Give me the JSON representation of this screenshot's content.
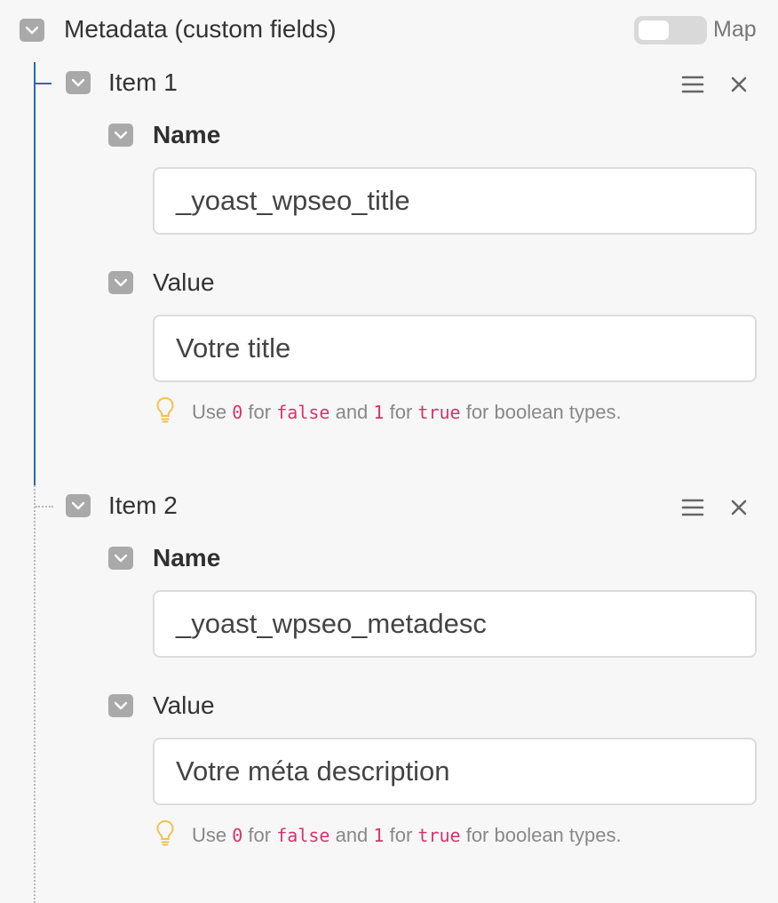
{
  "header": {
    "title": "Metadata (custom fields)",
    "toggle_label": "Map",
    "toggle_on": false
  },
  "items": [
    {
      "label": "Item 1",
      "name_label": "Name",
      "name_value": "_yoast_wpseo_title",
      "value_label": "Value",
      "value_value": "Votre title",
      "hint": {
        "use": "Use",
        "zero": "0",
        "for1": "for",
        "false": "false",
        "and": "and",
        "one": "1",
        "for2": "for",
        "true": "true",
        "rest": "for boolean types."
      }
    },
    {
      "label": "Item 2",
      "name_label": "Name",
      "name_value": "_yoast_wpseo_metadesc",
      "value_label": "Value",
      "value_value": "Votre méta description",
      "hint": {
        "use": "Use",
        "zero": "0",
        "for1": "for",
        "false": "false",
        "and": "and",
        "one": "1",
        "for2": "for",
        "true": "true",
        "rest": "for boolean types."
      }
    }
  ],
  "icons": {
    "collapse": "chevron-down-icon",
    "drag": "drag-handle-icon",
    "remove": "close-icon",
    "hint": "lightbulb-icon"
  },
  "colors": {
    "accent_line": "#2b6ca3",
    "code": "#d6336c",
    "checkbox": "#a9a9a9"
  }
}
